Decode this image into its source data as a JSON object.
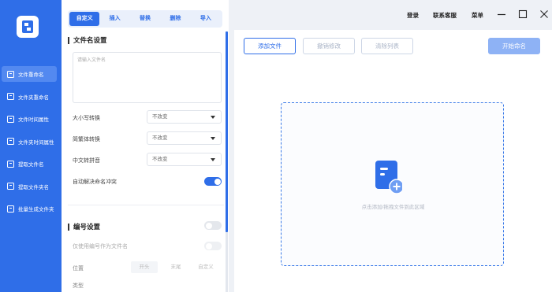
{
  "sidebar": {
    "logo_icon": "app-logo-icon",
    "items": [
      {
        "label": "文件重命名",
        "icon": "file-rename-icon",
        "active": true
      },
      {
        "label": "文件夹重命名",
        "icon": "folder-rename-icon",
        "active": false
      },
      {
        "label": "文件时间属性",
        "icon": "file-time-icon",
        "active": false
      },
      {
        "label": "文件夹时间属性",
        "icon": "folder-time-icon",
        "active": false
      },
      {
        "label": "提取文件名",
        "icon": "extract-filename-icon",
        "active": false
      },
      {
        "label": "提取文件夹名",
        "icon": "extract-foldername-icon",
        "active": false
      },
      {
        "label": "批量生成文件夹",
        "icon": "batch-create-folder-icon",
        "active": false
      }
    ]
  },
  "tabs": [
    {
      "label": "自定义",
      "active": true
    },
    {
      "label": "插入",
      "active": false
    },
    {
      "label": "替换",
      "active": false
    },
    {
      "label": "删除",
      "active": false
    },
    {
      "label": "导入",
      "active": false
    }
  ],
  "filename_settings": {
    "title": "文件名设置",
    "input_placeholder": "请输入文件名",
    "case_label": "大小写转换",
    "case_value": "不改变",
    "simp_trad_label": "简繁体转换",
    "simp_trad_value": "不改变",
    "pinyin_label": "中文转拼音",
    "pinyin_value": "不改变",
    "auto_resolve_label": "自动解决命名冲突",
    "auto_resolve_on": true
  },
  "numbering_settings": {
    "title": "编号设置",
    "enabled": false,
    "only_number_label": "仅使用编号作为文件名",
    "position_label": "位置",
    "position_options": [
      "开头",
      "末尾",
      "自定义"
    ],
    "type_label": "类型"
  },
  "toolbar": {
    "add_file": "添加文件",
    "undo": "撤销修改",
    "clear": "清除列表",
    "start": "开始命名"
  },
  "dropzone": {
    "hint": "点击添加/拖拽文件到此区域",
    "icon": "add-document-icon"
  },
  "titlebar": {
    "login": "登录",
    "support": "联系客服",
    "menu": "菜单"
  },
  "colors": {
    "accent": "#2f6ee8",
    "sidebar_bg": "#2f6ee8",
    "primary_disabled": "#8eb2f5"
  }
}
